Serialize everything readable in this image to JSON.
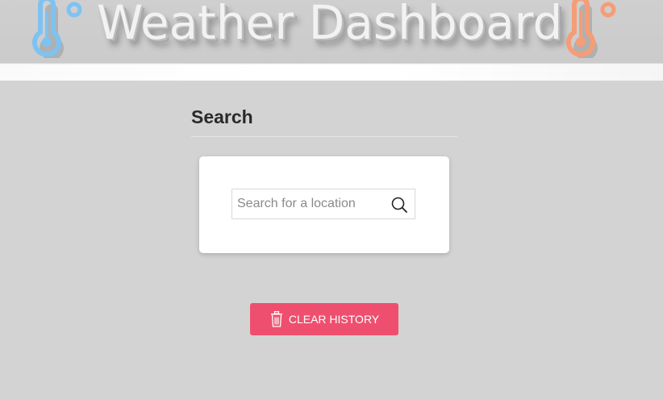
{
  "header": {
    "title": "Weather Dashboard",
    "left_icon": "thermometer-icon",
    "right_icon": "thermometer-icon",
    "left_icon_color": "#7ec2f2",
    "right_icon_color": "#f59d76"
  },
  "search_section": {
    "title": "Search",
    "input": {
      "placeholder": "Search for a location",
      "value": ""
    },
    "search_icon": "search-icon"
  },
  "actions": {
    "clear_history_label": "CLEAR HISTORY",
    "clear_history_icon": "trash-icon",
    "clear_history_color": "#ef4f6f"
  }
}
